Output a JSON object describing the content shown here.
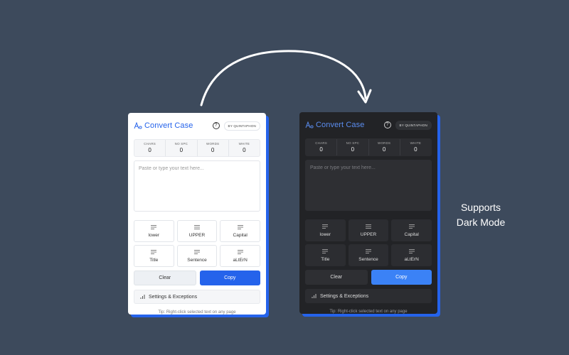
{
  "light": {
    "title": "Convert Case",
    "badge": "BY QUINTAPHON",
    "stats": [
      {
        "label": "CHARS",
        "value": "0"
      },
      {
        "label": "NO SPC",
        "value": "0"
      },
      {
        "label": "WORDS",
        "value": "0"
      },
      {
        "label": "WHITE",
        "value": "0"
      }
    ],
    "textarea_placeholder": "Paste or type your text here...",
    "cases": [
      "lower",
      "UPPER",
      "Capital",
      "Title",
      "Sentence",
      "aLtErN"
    ],
    "clear_label": "Clear",
    "copy_label": "Copy",
    "settings_label": "Settings & Exceptions",
    "tip": "Tip: Right-click selected text on any page"
  },
  "dark": {
    "title": "Convert Case",
    "badge": "BY QUINTAPHON",
    "stats": [
      {
        "label": "CHARS",
        "value": "0"
      },
      {
        "label": "NO SPC",
        "value": "0"
      },
      {
        "label": "WORDS",
        "value": "0"
      },
      {
        "label": "WHITE",
        "value": "0"
      }
    ],
    "textarea_placeholder": "Paste or type your text here...",
    "cases": [
      "lower",
      "UPPER",
      "Capital",
      "Title",
      "Sentence",
      "aLtErN"
    ],
    "clear_label": "Clear",
    "copy_label": "Copy",
    "settings_label": "Settings & Exceptions",
    "tip": "Tip: Right-click selected text on any page"
  },
  "caption": {
    "line1": "Supports",
    "line2": "Dark Mode"
  },
  "icons": {
    "logo": "text-case-icon",
    "help": "question-circle-icon",
    "case_buttons": "align-left-lines-icon",
    "settings": "bar-chart-icon",
    "arrow": "curved-arrow-icon"
  },
  "colors": {
    "background": "#3d4a5c",
    "accent": "#2563eb",
    "dark_panel": "#222326",
    "light_panel": "#ffffff"
  }
}
